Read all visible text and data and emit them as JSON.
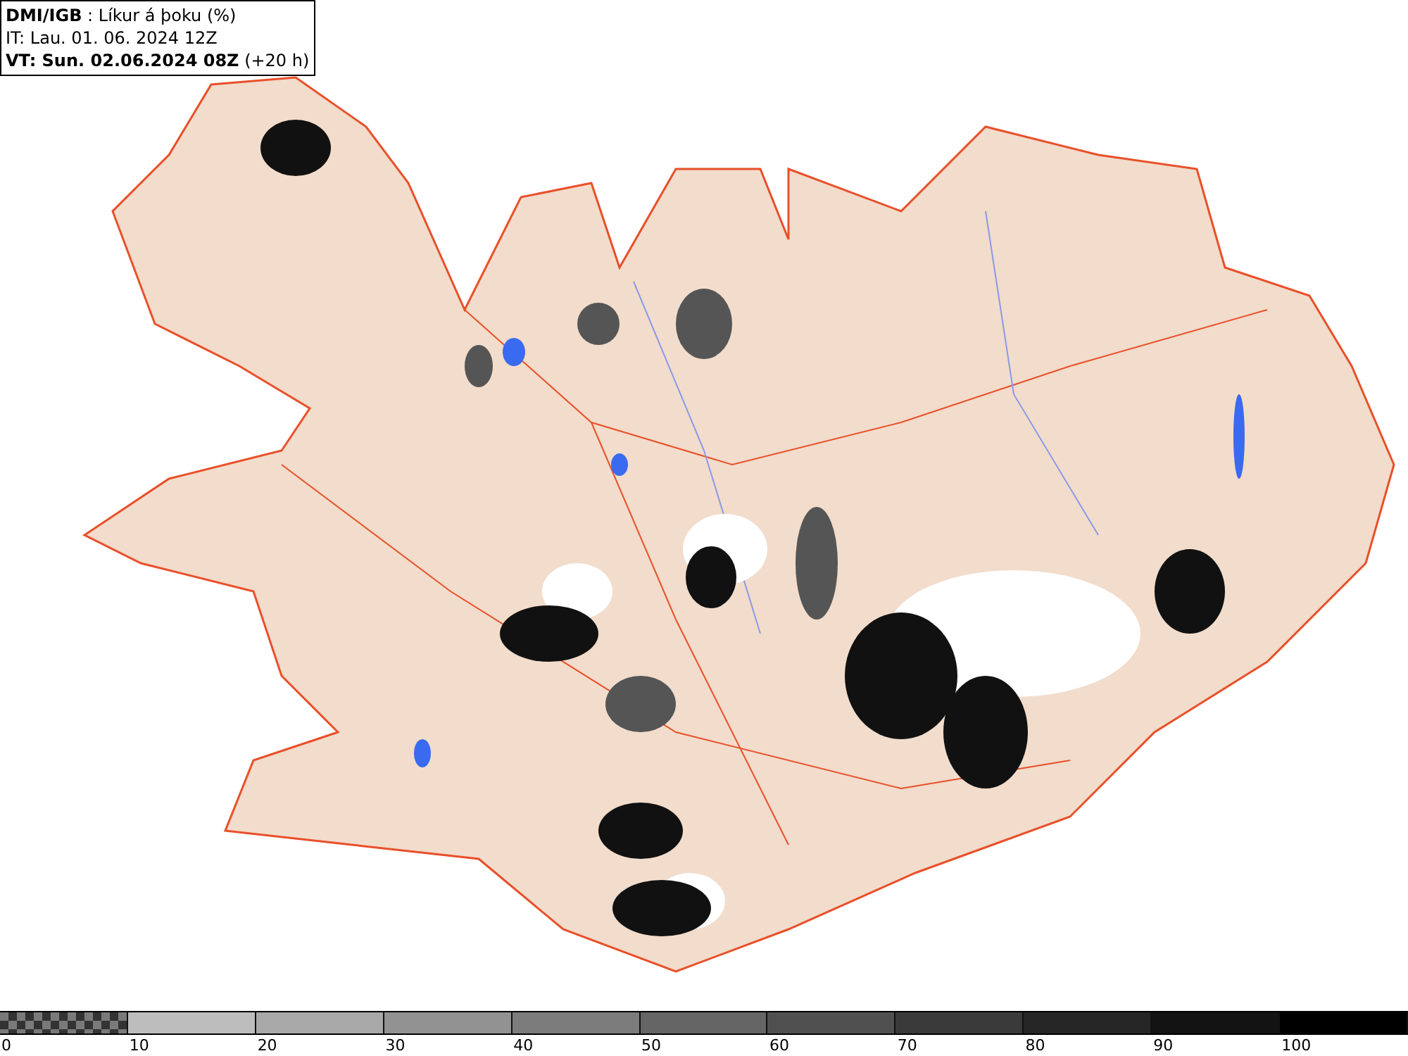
{
  "header": {
    "lines": [
      "**DMI/IGB** : Líkur á þoku (%)",
      "IT: Lau. 01. 06. 2024 12Z",
      "**VT: Sun. 02.06.2024 08Z** (+20 h)"
    ]
  },
  "legend": {
    "segments": [
      {
        "kind": "checker",
        "color": "#7a7a7a"
      },
      {
        "kind": "solid",
        "color": "#bdbdbd"
      },
      {
        "kind": "solid",
        "color": "#a8a8a8"
      },
      {
        "kind": "solid",
        "color": "#929292"
      },
      {
        "kind": "solid",
        "color": "#7c7c7c"
      },
      {
        "kind": "solid",
        "color": "#656565"
      },
      {
        "kind": "solid",
        "color": "#505050"
      },
      {
        "kind": "solid",
        "color": "#3a3a3a"
      },
      {
        "kind": "solid",
        "color": "#262626"
      },
      {
        "kind": "solid",
        "color": "#131313"
      },
      {
        "kind": "solid",
        "color": "#000000"
      }
    ],
    "labels": [
      "0",
      "10",
      "20",
      "30",
      "40",
      "50",
      "60",
      "70",
      "80",
      "90",
      "100"
    ]
  }
}
